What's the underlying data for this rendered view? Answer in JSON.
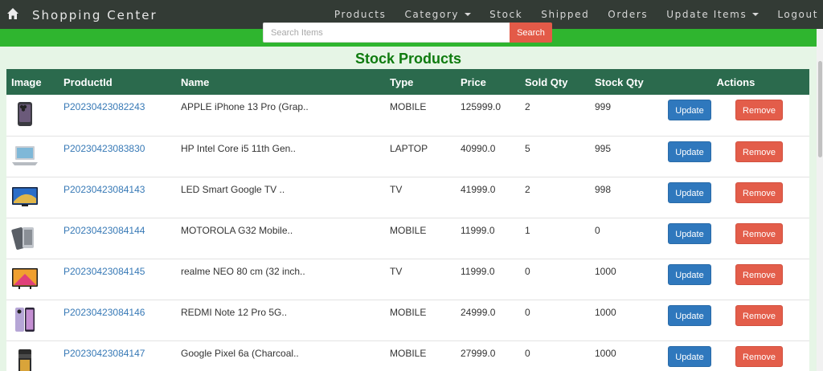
{
  "brand": "Shopping Center",
  "nav": {
    "products": "Products",
    "category": "Category",
    "stock": "Stock",
    "shipped": "Shipped",
    "orders": "Orders",
    "update_items": "Update Items",
    "logout": "Logout"
  },
  "search": {
    "placeholder": "Search Items",
    "button": "Search"
  },
  "page_title": "Stock Products",
  "table": {
    "headers": {
      "image": "Image",
      "product_id": "ProductId",
      "name": "Name",
      "type": "Type",
      "price": "Price",
      "sold_qty": "Sold Qty",
      "stock_qty": "Stock Qty",
      "actions": "Actions"
    },
    "update_label": "Update",
    "remove_label": "Remove",
    "rows": [
      {
        "product_id": "P20230423082243",
        "name": "APPLE iPhone 13 Pro (Grap..",
        "type": "MOBILE",
        "price": "125999.0",
        "sold_qty": "2",
        "stock_qty": "999",
        "image": "iphone-image"
      },
      {
        "product_id": "P20230423083830",
        "name": "HP Intel Core i5 11th Gen..",
        "type": "LAPTOP",
        "price": "40990.0",
        "sold_qty": "5",
        "stock_qty": "995",
        "image": "laptop-image"
      },
      {
        "product_id": "P20230423084143",
        "name": "LED Smart Google TV ..",
        "type": "TV",
        "price": "41999.0",
        "sold_qty": "2",
        "stock_qty": "998",
        "image": "tv-image"
      },
      {
        "product_id": "P20230423084144",
        "name": "MOTOROLA G32 Mobile..",
        "type": "MOBILE",
        "price": "11999.0",
        "sold_qty": "1",
        "stock_qty": "0",
        "image": "motorola-image"
      },
      {
        "product_id": "P20230423084145",
        "name": "realme NEO 80 cm (32 inch..",
        "type": "TV",
        "price": "11999.0",
        "sold_qty": "0",
        "stock_qty": "1000",
        "image": "realme-tv-image"
      },
      {
        "product_id": "P20230423084146",
        "name": "REDMI Note 12 Pro 5G..",
        "type": "MOBILE",
        "price": "24999.0",
        "sold_qty": "0",
        "stock_qty": "1000",
        "image": "redmi-image"
      },
      {
        "product_id": "P20230423084147",
        "name": "Google Pixel 6a (Charcoal..",
        "type": "MOBILE",
        "price": "27999.0",
        "sold_qty": "0",
        "stock_qty": "1000",
        "image": "pixel-image"
      }
    ]
  },
  "colors": {
    "navbar": "#333b35",
    "accent_green": "#2fb52f",
    "table_header": "#2b6a4d",
    "title_green": "#0f7b0f",
    "update_blue": "#2f78bd",
    "remove_red": "#e35d4a",
    "link_blue": "#3779b6"
  }
}
